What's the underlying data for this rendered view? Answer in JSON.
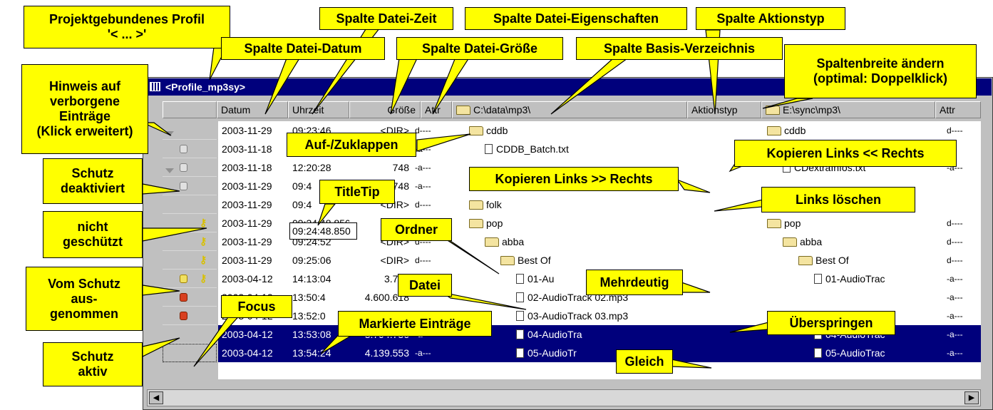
{
  "window": {
    "title": "<Profile_mp3sy>"
  },
  "columns": {
    "date": "Datum",
    "time": "Uhrzeit",
    "size": "Größe",
    "attr": "Attr",
    "left_base": "C:\\data\\mp3\\",
    "action": "Aktionstyp",
    "right_base": "E:\\sync\\mp3\\",
    "right_attr": "Attr"
  },
  "rows": [
    {
      "date": "2003-11-29",
      "time": "09:23:46",
      "size": "<DIR>",
      "attr": "d----",
      "lname": "cddb",
      "ltype": "folder",
      "action": "equal",
      "rname": "cddb",
      "rtype": "folder",
      "rattr": "d----",
      "selected": false
    },
    {
      "date": "2003-11-18",
      "time": "",
      "size": "",
      "attr": "-a---",
      "lname": "CDDB_Batch.txt",
      "ltype": "file",
      "action": "copy-left",
      "rname": "",
      "rtype": "",
      "rattr": "",
      "selected": false
    },
    {
      "date": "2003-11-18",
      "time": "12:20:28",
      "size": "748",
      "attr": "-a---",
      "lname": "",
      "ltype": "",
      "action": "copy-left",
      "rname": "CDextraInfos.txt",
      "rtype": "file",
      "rattr": "-a---",
      "selected": false
    },
    {
      "date": "2003-11-29",
      "time": "09:4",
      "size": "748",
      "attr": "-a---",
      "lname": "",
      "ltype": "",
      "action": "copy-right",
      "rname": "",
      "rtype": "",
      "rattr": "",
      "selected": false
    },
    {
      "date": "2003-11-29",
      "time": "09:4",
      "size": "<DIR>",
      "attr": "d----",
      "lname": "folk",
      "ltype": "folder",
      "action": "delete-left",
      "rname": "",
      "rtype": "",
      "rattr": "",
      "selected": false
    },
    {
      "date": "2003-11-29",
      "time": "09:24:48.850",
      "size": "",
      "attr": "",
      "lname": "pop",
      "ltype": "folder",
      "action": "equal",
      "rname": "pop",
      "rtype": "folder",
      "rattr": "d----",
      "selected": false
    },
    {
      "date": "2003-11-29",
      "time": "09:24:52",
      "size": "<DIR>",
      "attr": "d----",
      "lname": "abba",
      "ltype": "folder",
      "action": "equal",
      "rname": "abba",
      "rtype": "folder",
      "rattr": "d----",
      "selected": false
    },
    {
      "date": "2003-11-29",
      "time": "09:25:06",
      "size": "<DIR>",
      "attr": "d----",
      "lname": "Best Of",
      "ltype": "folder",
      "action": "equal",
      "rname": "Best Of",
      "rtype": "folder",
      "rattr": "d----",
      "selected": false
    },
    {
      "date": "2003-04-12",
      "time": "14:13:04",
      "size": "3.710",
      "attr": "",
      "lname": "01-Au",
      "ltype": "file",
      "action": "ambiguous",
      "rname": "01-AudioTrac",
      "rtype": "file",
      "rattr": "-a---",
      "selected": false
    },
    {
      "date": "2003-04-12",
      "time": "13:50:4",
      "size": "4.600.618",
      "attr": "",
      "lname": "02-AudioTrack 02.mp3",
      "ltype": "file",
      "action": "skip",
      "rname": "",
      "rtype": "",
      "rattr": "-a---",
      "selected": false
    },
    {
      "date": "2003-04-12",
      "time": "13:52:0",
      "size": "",
      "attr": "",
      "lname": "03-AudioTrack 03.mp3",
      "ltype": "file",
      "action": "skip",
      "rname": "ioTrac",
      "rtype": "",
      "rattr": "-a---",
      "selected": false
    },
    {
      "date": "2003-04-12",
      "time": "13:53:08",
      "size": "3.794.736",
      "attr": "-a---",
      "lname": "04-AudioTra",
      "ltype": "file",
      "action": "equal",
      "rname": "04-AudioTrac",
      "rtype": "file",
      "rattr": "-a---",
      "selected": true
    },
    {
      "date": "2003-04-12",
      "time": "13:54:24",
      "size": "4.139.553",
      "attr": "-a---",
      "lname": "05-AudioTr",
      "ltype": "file",
      "action": "equal",
      "rname": "05-AudioTrac",
      "rtype": "file",
      "rattr": "-a---",
      "selected": true
    }
  ],
  "callouts": {
    "profile": "Projektgebundenes Profil\n'< ... >'",
    "col_time": "Spalte Datei-Zeit",
    "col_props": "Spalte Datei-Eigenschaften",
    "col_action": "Spalte Aktionstyp",
    "col_date": "Spalte Datei-Datum",
    "col_size": "Spalte Datei-Größe",
    "col_base": "Spalte Basis-Verzeichnis",
    "col_width": "Spaltenbreite ändern\n(optimal: Doppelklick)",
    "hidden": "Hinweis auf\nverborgene\nEinträge\n(Klick erweitert)",
    "collapse": "Auf-/Zuklappen",
    "copy_left": "Kopieren Links << Rechts",
    "prot_off": "Schutz\ndeaktiviert",
    "copy_right": "Kopieren Links >> Rechts",
    "titletip": "TitleTip",
    "delete_left": "Links löschen",
    "unprotected": "nicht\ngeschützt",
    "folder": "Ordner",
    "exempt": "Vom Schutz\naus-\ngenommen",
    "file": "Datei",
    "ambiguous": "Mehrdeutig",
    "focus": "Focus",
    "marked": "Markierte Einträge",
    "skip": "Überspringen",
    "prot_on": "Schutz\naktiv",
    "equal": "Gleich"
  },
  "colors": {
    "titlebar": "#00007c",
    "callout": "#ffff00",
    "selection": "#00007c"
  }
}
